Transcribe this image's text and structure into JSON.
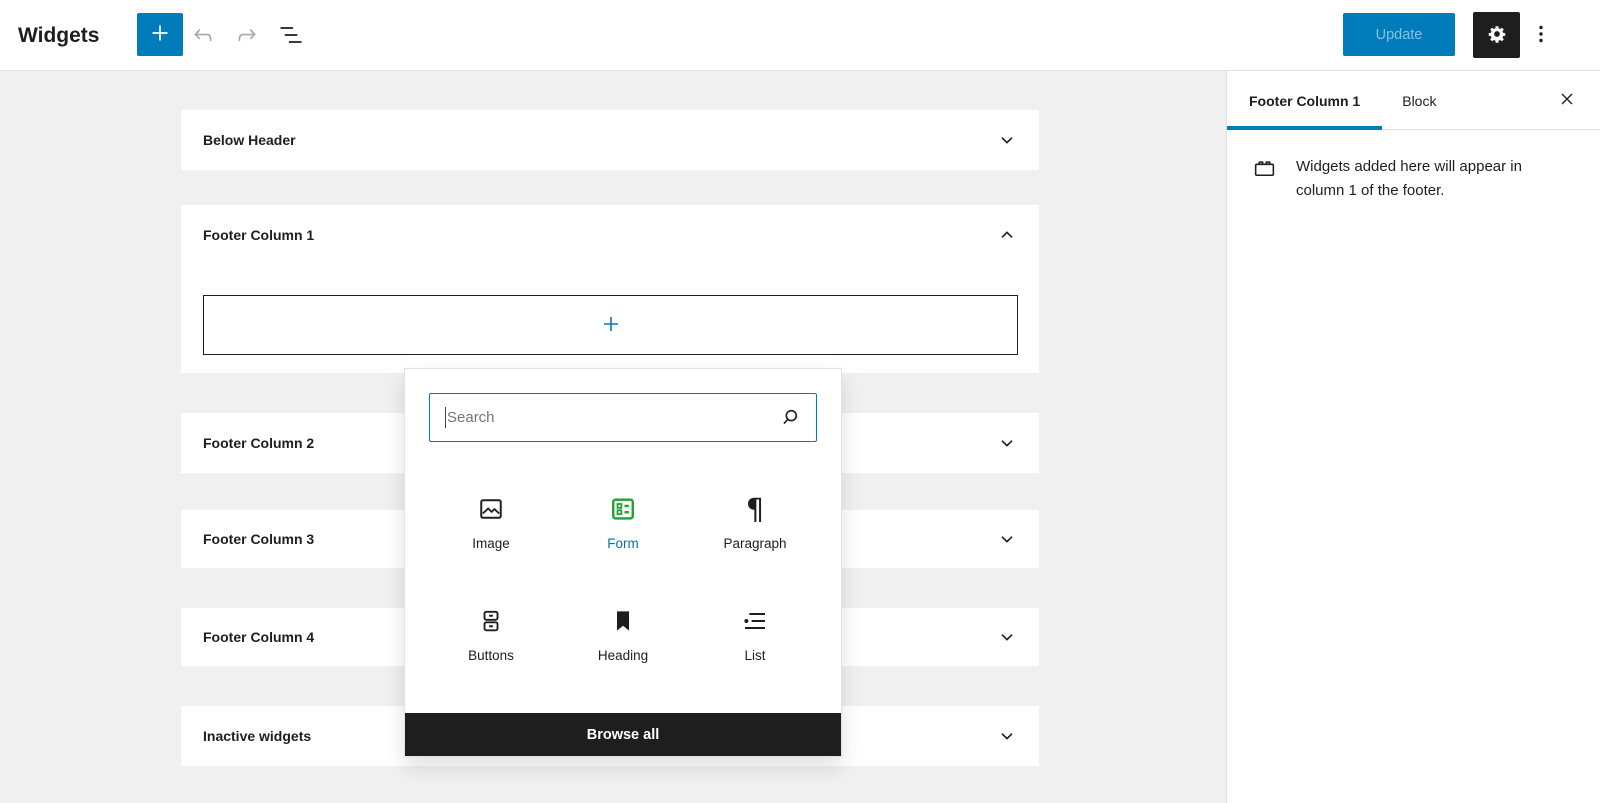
{
  "topbar": {
    "title": "Widgets",
    "update_label": "Update",
    "icons": [
      "plus-icon",
      "undo-icon",
      "redo-icon",
      "list-view-icon",
      "settings-gear-icon",
      "options-kebab-icon"
    ]
  },
  "widget_areas": [
    {
      "label": "Below Header",
      "expanded": false
    },
    {
      "label": "Footer Column 1",
      "expanded": true
    },
    {
      "label": "Footer Column 2",
      "expanded": false
    },
    {
      "label": "Footer Column 3",
      "expanded": false
    },
    {
      "label": "Footer Column 4",
      "expanded": false
    },
    {
      "label": "Inactive widgets",
      "expanded": false
    }
  ],
  "inserter": {
    "search_placeholder": "Search",
    "search_value": "",
    "blocks": [
      {
        "label": "Image",
        "icon": "image-icon"
      },
      {
        "label": "Form",
        "icon": "form-icon",
        "icon_color": "#1ea12d",
        "label_color": "#0073aa"
      },
      {
        "label": "Paragraph",
        "icon": "paragraph-icon",
        "glyph": "¶"
      },
      {
        "label": "Buttons",
        "icon": "buttons-icon"
      },
      {
        "label": "Heading",
        "icon": "heading-icon"
      },
      {
        "label": "List",
        "icon": "list-icon"
      }
    ],
    "browse_all_label": "Browse all"
  },
  "sidebar": {
    "tabs": [
      {
        "label": "Footer Column 1",
        "active": true
      },
      {
        "label": "Block",
        "active": false
      }
    ],
    "icon": "widget-area-icon",
    "description": "Widgets added here will appear in column 1 of the footer."
  },
  "colors": {
    "accent": "#007cba",
    "dark": "#1e1e1e",
    "canvas": "#f0f0f0",
    "border": "#e0e0e0",
    "muted_text": "#757575",
    "form_green": "#1ea12d",
    "form_label_blue": "#0073aa",
    "update_disabled_text": "rgba(255,255,255,0.52)"
  }
}
